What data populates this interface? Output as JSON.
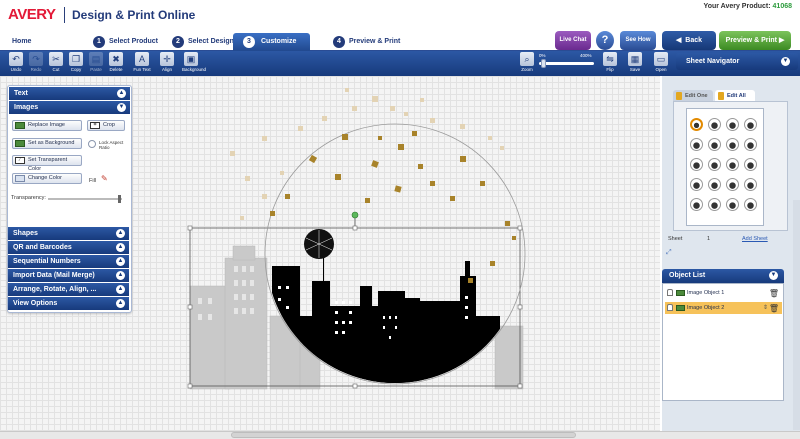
{
  "header": {
    "logo": "AVERY",
    "title": "Design & Print Online",
    "product_label": "Your Avery Product:",
    "product_number": "41068"
  },
  "steps": {
    "home": "Home",
    "items": [
      {
        "num": "1",
        "label": "Select Product"
      },
      {
        "num": "2",
        "label": "Select Design"
      },
      {
        "num": "3",
        "label": "Customize"
      },
      {
        "num": "4",
        "label": "Preview & Print"
      }
    ]
  },
  "header_buttons": {
    "live_chat": "Live Chat",
    "help": "?",
    "see_how": "See How",
    "back": "Back",
    "preview_print": "Preview & Print"
  },
  "toolbar": {
    "tools": [
      "Undo",
      "Redo",
      "Cut",
      "Copy",
      "Paste",
      "Delete",
      "Fun Text",
      "Align",
      "Background"
    ],
    "zoom_label": "Zoom",
    "zoom_min": "0%",
    "zoom_max": "400%",
    "right_tools": [
      "Flip",
      "Save",
      "Open"
    ]
  },
  "left_panel": {
    "sections_top": [
      {
        "label": "Text",
        "chev": "▲"
      },
      {
        "label": "Images",
        "chev": "▼"
      }
    ],
    "buttons": {
      "replace_image": "Replace Image",
      "crop": "Crop",
      "set_background": "Set as Background",
      "lock_aspect": "Lock Aspect Ratio",
      "set_transparent": "Set Transparent Color",
      "change_color": "Change Color",
      "fill": "Fill",
      "transparency": "Transparency:"
    },
    "sections_bottom": [
      {
        "label": "Shapes",
        "chev": "▲"
      },
      {
        "label": "QR and Barcodes",
        "chev": "▲"
      },
      {
        "label": "Sequential Numbers",
        "chev": "▲"
      },
      {
        "label": "Import Data (Mail Merge)",
        "chev": "▲"
      },
      {
        "label": "Arrange, Rotate, Align, ...",
        "chev": "▲"
      },
      {
        "label": "View Options",
        "chev": "▲"
      }
    ]
  },
  "sheet_navigator": {
    "title": "Sheet Navigator",
    "tab_edit_one": "Edit One",
    "tab_edit_all": "Edit All",
    "sheet_label": "Sheet",
    "sheet_number": "1",
    "add_sheet": "Add Sheet"
  },
  "object_list": {
    "title": "Object List",
    "items": [
      {
        "label": "Image Object 1",
        "selected": false
      },
      {
        "label": "Image Object 2",
        "selected": true
      }
    ]
  },
  "colors": {
    "brand_red": "#e31937",
    "nav_blue": "#173a7c",
    "accent_green": "#3c8a22",
    "highlight_orange": "#f6c25a",
    "confetti_gold": "#a8832a"
  }
}
